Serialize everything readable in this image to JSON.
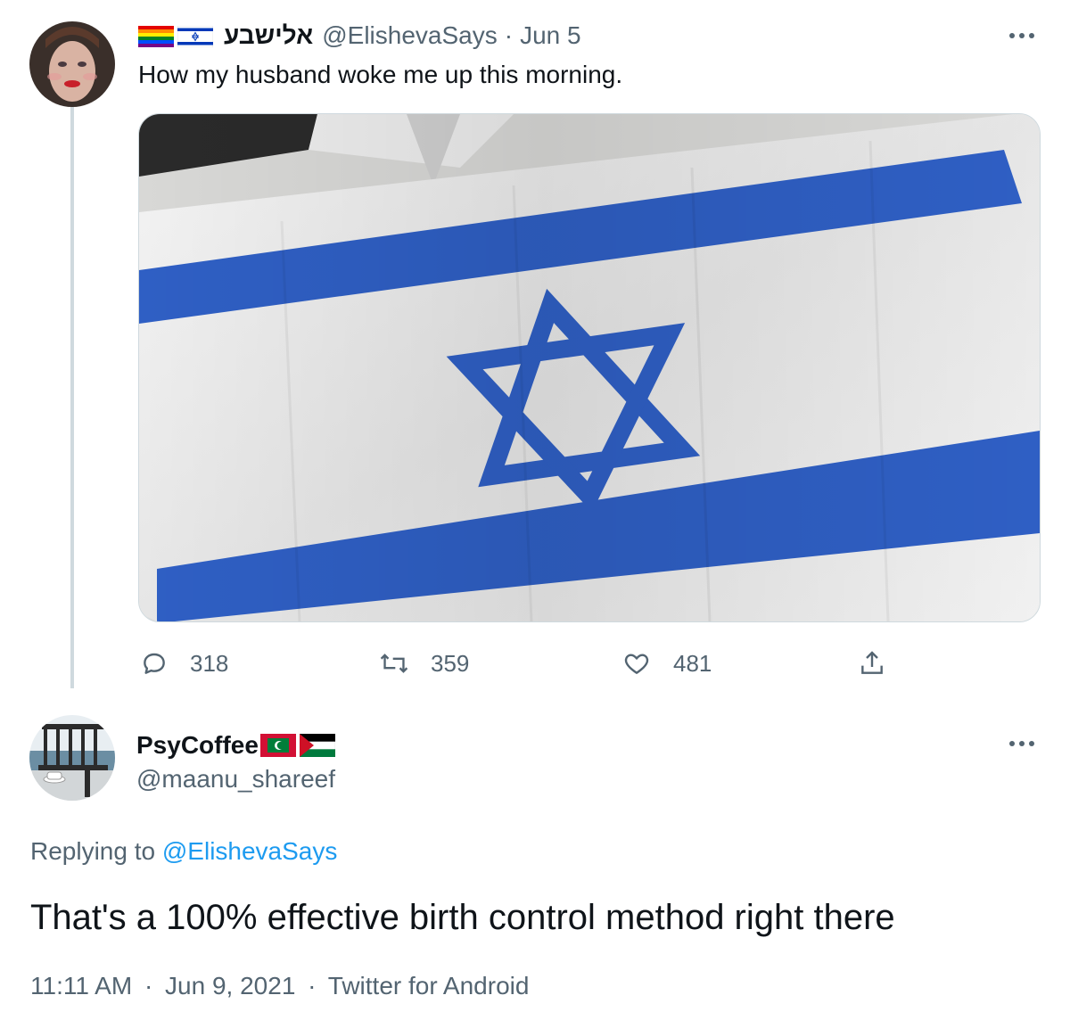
{
  "tweet": {
    "display_name": "אלישבע",
    "handle": "@ElishevaSays",
    "separator": "·",
    "date": "Jun 5",
    "text": "How my husband woke me up this morning.",
    "actions": {
      "replies": "318",
      "retweets": "359",
      "likes": "481"
    },
    "icons": [
      "rainbow-flag-icon",
      "israel-flag-icon",
      "reply-icon",
      "retweet-icon",
      "like-icon",
      "share-icon",
      "more-icon"
    ]
  },
  "reply": {
    "display_name": "PsyCoffee",
    "handle": "@maanu_shareef",
    "replying_prefix": "Replying to",
    "replying_to": "@ElishevaSays",
    "text": "That's a 100% effective birth control method right there",
    "time": "11:11 AM",
    "separator": "·",
    "date": "Jun 9, 2021",
    "source": "Twitter for Android",
    "icons": [
      "maldives-flag-icon",
      "palestine-flag-icon",
      "more-icon"
    ]
  },
  "colors": {
    "text": "#0f1419",
    "muted": "#536471",
    "link": "#1d9bf0",
    "border": "#cfd9de",
    "flag_blue": "#2f5fc4"
  }
}
